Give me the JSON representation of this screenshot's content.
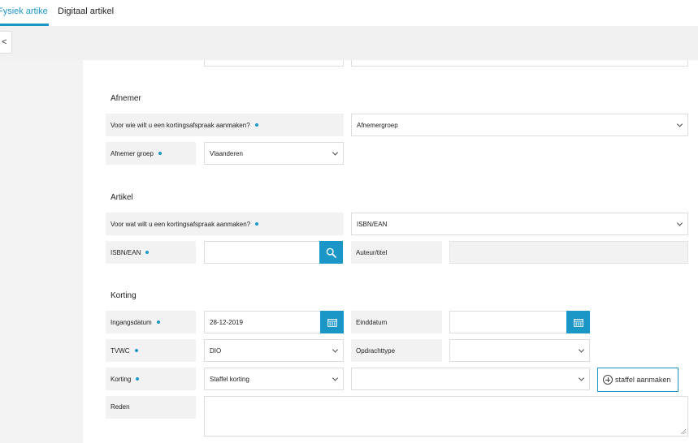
{
  "tabs": {
    "physical": "Fysiek artikel",
    "digital": "Digitaal artikel"
  },
  "toolbar": {
    "back_label": "<"
  },
  "afnemer": {
    "title": "Afnemer",
    "who_label": "Voor wie wilt u een kortingsafspraak aanmaken?",
    "who_value": "Afnemergroep",
    "group_label": "Afnemer groep",
    "group_value": "Vlaanderen"
  },
  "artikel": {
    "title": "Artikel",
    "what_label": "Voor wat wilt u een kortingsafspraak aanmaken?",
    "what_value": "ISBN/EAN",
    "isbn_label": "ISBN/EAN",
    "isbn_value": "",
    "author_label": "Auteur/titel",
    "author_value": ""
  },
  "korting": {
    "title": "Korting",
    "start_label": "Ingangsdatum",
    "start_value": "28-12-2019",
    "end_label": "Einddatum",
    "end_value": "",
    "tvwc_label": "TVWC",
    "tvwc_value": "DIO",
    "order_type_label": "Opdrachttype",
    "order_type_value": "",
    "discount_label": "Korting",
    "discount_value": "Staffel korting",
    "discount_extra_value": "",
    "staffel_button": "staffel aanmaken",
    "reason_label": "Reden",
    "reason_value": ""
  },
  "colors": {
    "accent": "#1a96c7",
    "label_bg": "#f2f2f2",
    "toolbar_bg": "#f1f1f1"
  },
  "icons": [
    "search-icon",
    "calendar-icon",
    "chevron-down-icon",
    "plus-circle-icon"
  ]
}
